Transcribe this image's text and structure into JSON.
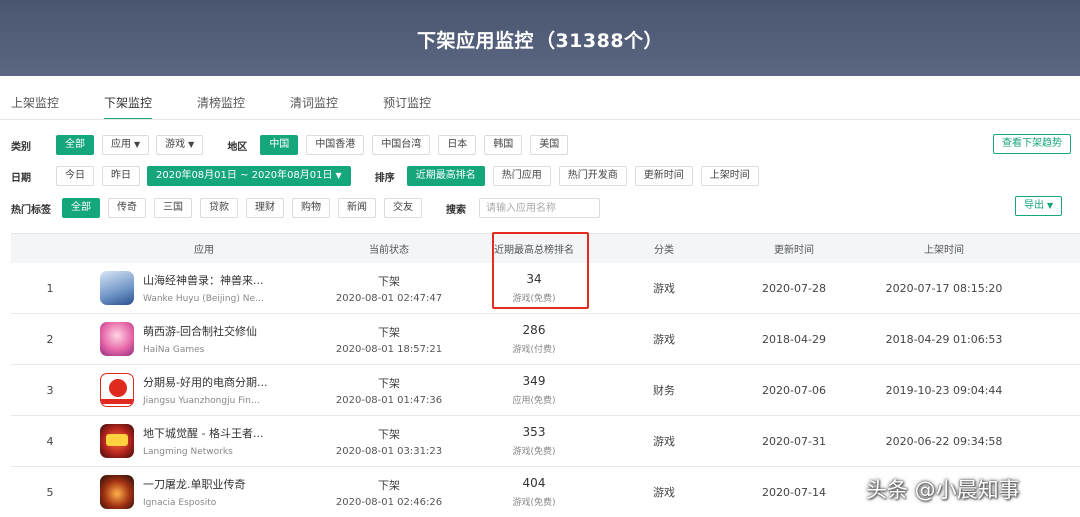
{
  "header": {
    "title": "下架应用监控",
    "count": "（31388个）"
  },
  "tabs": [
    "上架监控",
    "下架监控",
    "清榜监控",
    "清词监控",
    "预订监控"
  ],
  "filters": {
    "category": {
      "label": "类别",
      "all": "全部",
      "app": "应用",
      "game": "游戏"
    },
    "region": {
      "label": "地区",
      "options": [
        "中国",
        "中国香港",
        "中国台湾",
        "日本",
        "韩国",
        "美国"
      ]
    },
    "date": {
      "label": "日期",
      "today": "今日",
      "yesterday": "昨日",
      "range": "2020年08月01日 ~ 2020年08月01日"
    },
    "sort": {
      "label": "排序",
      "options": [
        "近期最高排名",
        "热门应用",
        "热门开发商",
        "更新时间",
        "上架时间"
      ]
    },
    "hot_tags": {
      "label": "热门标签",
      "options": [
        "全部",
        "传奇",
        "三国",
        "贷款",
        "理财",
        "购物",
        "新闻",
        "交友"
      ]
    },
    "search": {
      "label": "搜索",
      "placeholder": "请输入应用名称"
    },
    "trend_button": "查看下架趋势",
    "export_button": "导出"
  },
  "table": {
    "headers": {
      "app": "应用",
      "status": "当前状态",
      "rank": "近期最高总榜排名",
      "category": "分类",
      "updated": "更新时间",
      "listed": "上架时间"
    },
    "rows": [
      {
        "idx": "1",
        "name": "山海经神兽录：神兽来...",
        "dev": "Wanke Huyu (Beijing) Netw...",
        "status": "下架",
        "time": "2020-08-01 02:47:47",
        "rank": "34",
        "rank_type": "游戏(免费)",
        "category": "游戏",
        "updated": "2020-07-28",
        "listed": "2020-07-17 08:15:20"
      },
      {
        "idx": "2",
        "name": "萌西游-回合制社交修仙",
        "dev": "HaiNa Games",
        "status": "下架",
        "time": "2020-08-01 18:57:21",
        "rank": "286",
        "rank_type": "游戏(付费)",
        "category": "游戏",
        "updated": "2018-04-29",
        "listed": "2018-04-29 01:06:53"
      },
      {
        "idx": "3",
        "name": "分期易-好用的电商分期...",
        "dev": "Jiangsu Yuanzhongju Finan...",
        "status": "下架",
        "time": "2020-08-01 01:47:36",
        "rank": "349",
        "rank_type": "应用(免费)",
        "category": "财务",
        "updated": "2020-07-06",
        "listed": "2019-10-23 09:04:44"
      },
      {
        "idx": "4",
        "name": "地下城觉醒 - 格斗王者...",
        "dev": "Langming Networks",
        "status": "下架",
        "time": "2020-08-01 03:31:23",
        "rank": "353",
        "rank_type": "游戏(免费)",
        "category": "游戏",
        "updated": "2020-07-31",
        "listed": "2020-06-22 09:34:58"
      },
      {
        "idx": "5",
        "name": "一刀屠龙.单职业传奇",
        "dev": "Ignacia Esposito",
        "status": "下架",
        "time": "2020-08-01 02:46:26",
        "rank": "404",
        "rank_type": "游戏(免费)",
        "category": "游戏",
        "updated": "2020-07-14",
        "listed": ""
      }
    ]
  },
  "watermark": "头条 @小晨知事",
  "colors": {
    "accent": "#15a67b",
    "header_bg": "#4f5b75",
    "highlight": "#e52a20"
  }
}
